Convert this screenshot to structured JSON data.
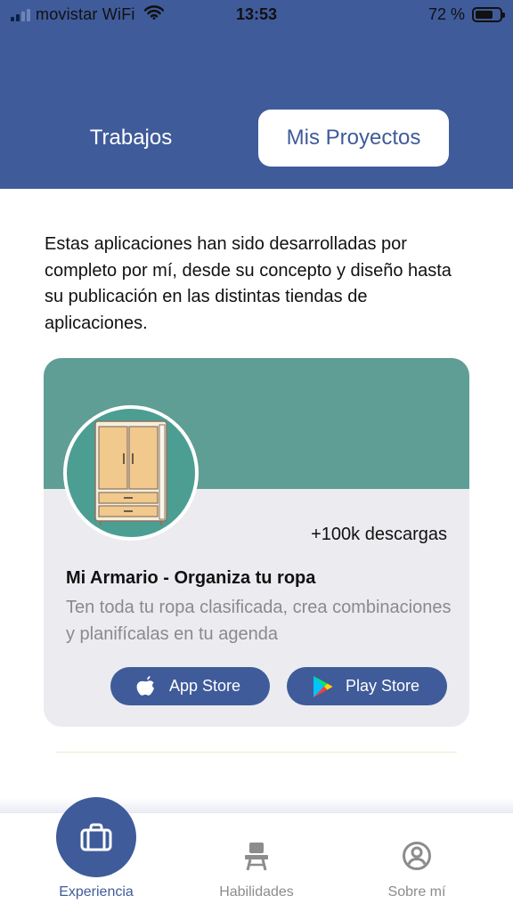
{
  "status_bar": {
    "carrier": "movistar WiFi",
    "time": "13:53",
    "battery": "72 %",
    "battery_level": 0.72
  },
  "tabs": [
    {
      "label": "Trabajos",
      "selected": false
    },
    {
      "label": "Mis Proyectos",
      "selected": true
    }
  ],
  "intro_text": "Estas aplicaciones han sido desarrolladas por completo por mí, desde su concepto y diseño hasta su publicación en las distintas tiendas de aplicaciones.",
  "project": {
    "downloads": "+100k descargas",
    "title": "Mi Armario - Organiza tu ropa",
    "description": "Ten toda tu ropa clasificada, crea combinaciones y planifícalas en tu agenda",
    "icon": "wardrobe-icon",
    "buttons": {
      "app_store": "App Store",
      "play_store": "Play Store"
    }
  },
  "bottom_nav": [
    {
      "label": "Experiencia",
      "icon": "briefcase-icon",
      "active": true
    },
    {
      "label": "Habilidades",
      "icon": "school-desk-icon",
      "active": false
    },
    {
      "label": "Sobre mí",
      "icon": "user-circle-icon",
      "active": false
    }
  ],
  "colors": {
    "primary": "#3f5b9a",
    "card_banner": "#5f9e94",
    "card_bg": "#ececf0",
    "muted_text": "#8a8a8e"
  }
}
